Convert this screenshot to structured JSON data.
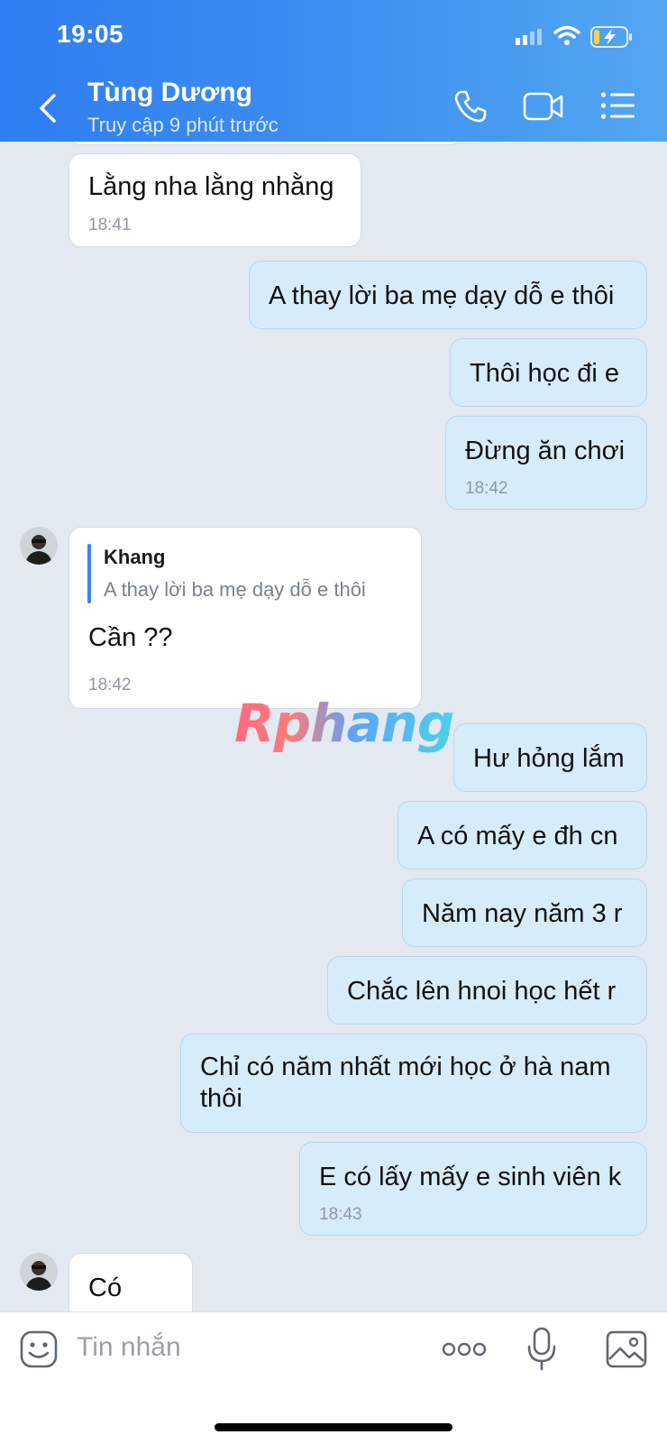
{
  "status_bar": {
    "time": "19:05"
  },
  "header": {
    "title": "Tùng Dương",
    "subtitle": "Truy cập 9 phút trước",
    "icons": [
      "back-icon",
      "phone-icon",
      "video-icon",
      "menu-list-icon"
    ]
  },
  "messages": [
    {
      "side": "in",
      "text": "Lằng nha lằng nhằng",
      "time": "18:41"
    },
    {
      "side": "out",
      "text": "A thay lời ba mẹ dạy dỗ e thôi"
    },
    {
      "side": "out",
      "text": "Thôi học đi e"
    },
    {
      "side": "out",
      "text": "Đừng ăn chơi",
      "time": "18:42"
    },
    {
      "side": "in",
      "reply_to": {
        "name": "Khang",
        "text": "A thay lời ba mẹ dạy dỗ e thôi"
      },
      "text": "Cần ??",
      "time": "18:42"
    },
    {
      "side": "out",
      "text": "Hư hỏng lắm"
    },
    {
      "side": "out",
      "text": "A có mấy e đh cn"
    },
    {
      "side": "out",
      "text": "Năm nay năm 3 r"
    },
    {
      "side": "out",
      "text": "Chắc lên hnoi học hết r"
    },
    {
      "side": "out",
      "text_lines": [
        "Chỉ có năm nhất mới học ở hà nam",
        "thôi"
      ]
    },
    {
      "side": "out",
      "text": "E có lấy mấy e sinh viên k",
      "time": "18:43"
    },
    {
      "side": "in",
      "text": "Có"
    }
  ],
  "watermark": "Rphang",
  "composer": {
    "placeholder": "Tin nhắn",
    "icons": [
      "sticker-icon",
      "more-icon",
      "microphone-icon",
      "image-icon"
    ]
  },
  "colors": {
    "header_start": "#2f7df2",
    "header_end": "#54a6f1",
    "out_bubble": "#d7ecfb",
    "in_bubble": "#ffffff",
    "chat_bg": "#e3e9f1"
  }
}
